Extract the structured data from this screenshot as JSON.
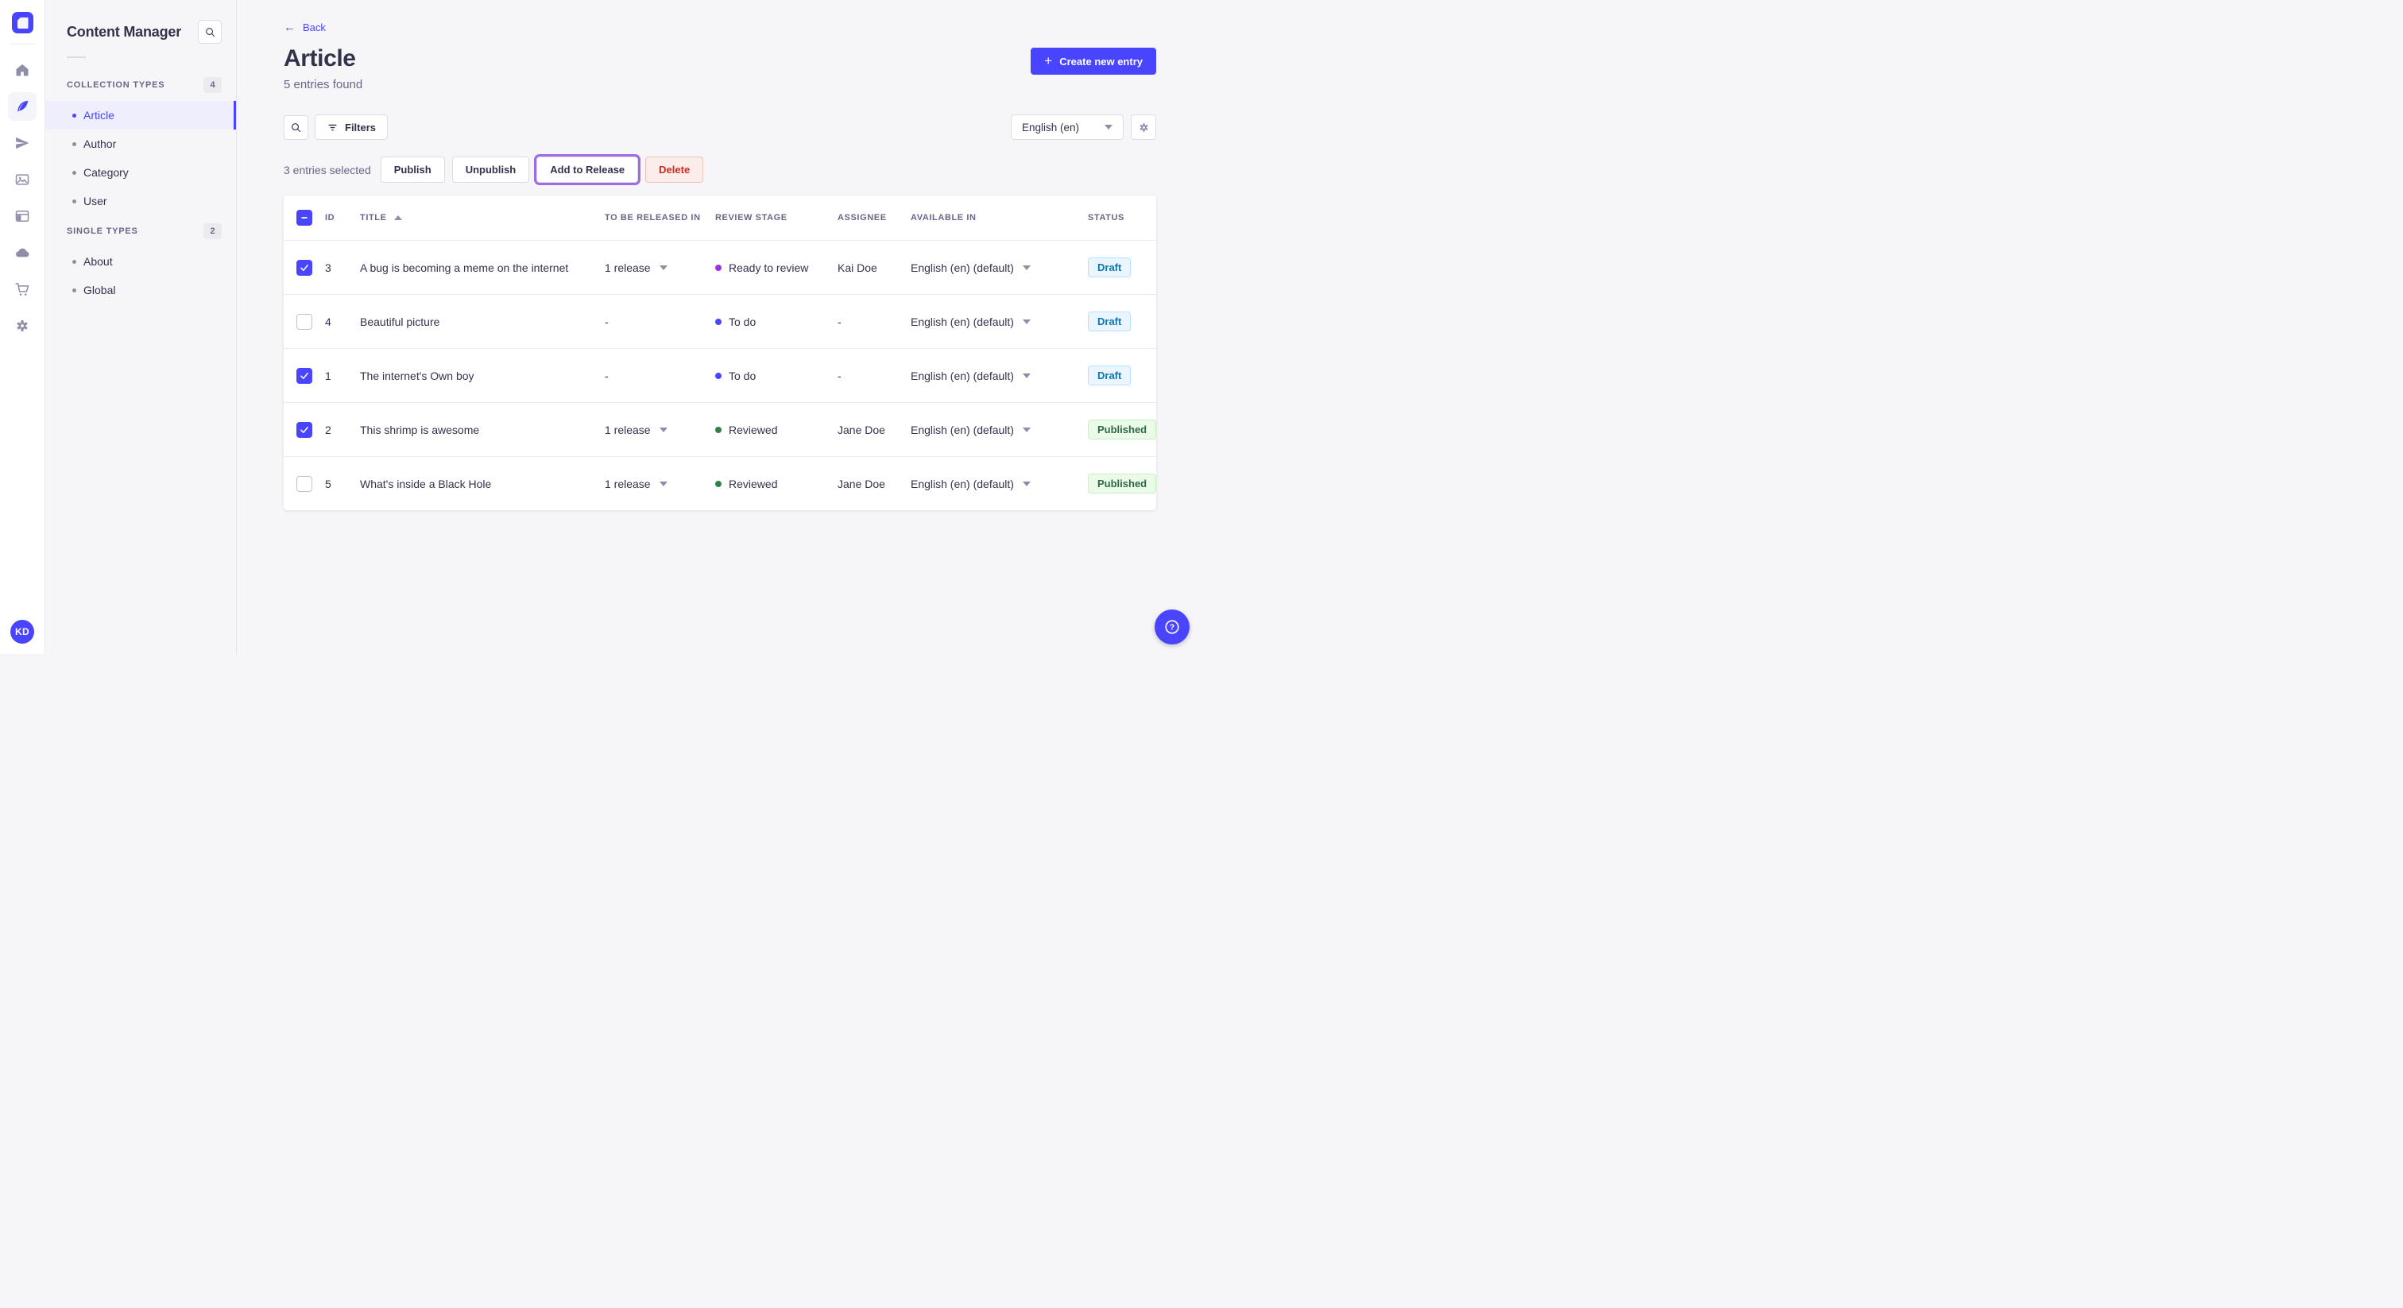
{
  "nav": {
    "items": [
      {
        "icon": "home-icon",
        "active": false
      },
      {
        "icon": "content-feather-icon",
        "active": true
      },
      {
        "icon": "releases-paper-plane-icon",
        "active": false
      },
      {
        "icon": "media-library-icon",
        "active": false
      },
      {
        "icon": "content-type-builder-icon",
        "active": false
      },
      {
        "icon": "deploy-cloud-icon",
        "active": false
      },
      {
        "icon": "marketplace-cart-icon",
        "active": false
      },
      {
        "icon": "settings-gear-icon",
        "active": false
      }
    ],
    "avatar_initials": "KD"
  },
  "sidebar": {
    "title": "Content Manager",
    "sections": [
      {
        "label": "COLLECTION TYPES",
        "count": "4",
        "items": [
          {
            "label": "Article",
            "active": true
          },
          {
            "label": "Author",
            "active": false
          },
          {
            "label": "Category",
            "active": false
          },
          {
            "label": "User",
            "active": false
          }
        ]
      },
      {
        "label": "SINGLE TYPES",
        "count": "2",
        "items": [
          {
            "label": "About",
            "active": false
          },
          {
            "label": "Global",
            "active": false
          }
        ]
      }
    ]
  },
  "header": {
    "back_label": "Back",
    "title": "Article",
    "subtitle": "5 entries found",
    "create_button": "Create new entry"
  },
  "toolbar": {
    "filters_label": "Filters",
    "locale_selected": "English (en)"
  },
  "selection": {
    "text": "3 entries selected",
    "publish_label": "Publish",
    "unpublish_label": "Unpublish",
    "add_to_release_label": "Add to Release",
    "delete_label": "Delete"
  },
  "table": {
    "header_checkbox": "indeterminate",
    "sort_column": "TITLE",
    "sort_direction": "asc",
    "columns": [
      "ID",
      "TITLE",
      "TO BE RELEASED IN",
      "REVIEW STAGE",
      "ASSIGNEE",
      "AVAILABLE IN",
      "STATUS"
    ],
    "rows": [
      {
        "checked": true,
        "id": "3",
        "title": "A bug is becoming a meme on the internet",
        "released": "1 release",
        "stage": "Ready to review",
        "stage_color": "#9736e8",
        "assignee": "Kai Doe",
        "locale": "English (en) (default)",
        "status": "Draft"
      },
      {
        "checked": false,
        "id": "4",
        "title": "Beautiful picture",
        "released": "-",
        "stage": "To do",
        "stage_color": "#4945ff",
        "assignee": "-",
        "locale": "English (en) (default)",
        "status": "Draft"
      },
      {
        "checked": true,
        "id": "1",
        "title": "The internet's Own boy",
        "released": "-",
        "stage": "To do",
        "stage_color": "#4945ff",
        "assignee": "-",
        "locale": "English (en) (default)",
        "status": "Draft"
      },
      {
        "checked": true,
        "id": "2",
        "title": "This shrimp is awesome",
        "released": "1 release",
        "stage": "Reviewed",
        "stage_color": "#328048",
        "assignee": "Jane Doe",
        "locale": "English (en) (default)",
        "status": "Published"
      },
      {
        "checked": false,
        "id": "5",
        "title": "What's inside a Black Hole",
        "released": "1 release",
        "stage": "Reviewed",
        "stage_color": "#328048",
        "assignee": "Jane Doe",
        "locale": "English (en) (default)",
        "status": "Published"
      }
    ]
  },
  "colors": {
    "primary": "#4945ff",
    "active_item_bg": "#eeeefc",
    "focus_ring_purple": "#9c6ce6",
    "draft_text": "#0c75af",
    "draft_bg": "#eaf5ff",
    "published_text": "#2f6846",
    "published_bg": "#eafbe7",
    "delete_text": "#d02b20",
    "delete_bg": "#fcecea"
  }
}
